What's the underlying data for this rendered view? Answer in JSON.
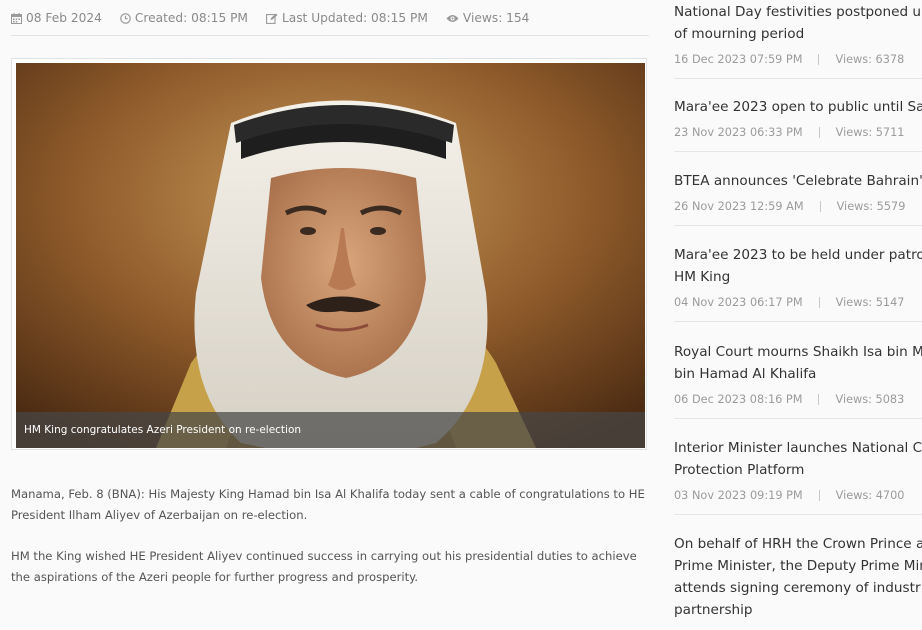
{
  "article": {
    "date": "08 Feb 2024",
    "created": "Created: 08:15 PM",
    "updated": "Last Updated: 08:15 PM",
    "views": "Views: 154",
    "image_caption": "HM King congratulates Azeri President on re-election",
    "paragraphs": [
      "Manama, Feb. 8 (BNA): His Majesty King Hamad bin Isa Al Khalifa today sent a cable of congratulations to HE President Ilham Aliyev of Azerbaijan on re-election.",
      "HM the King wished HE President Aliyev continued success in carrying out his presidential duties to achieve the aspirations of the Azeri people for further progress and prosperity."
    ]
  },
  "sidebar": {
    "items": [
      {
        "title_lines": [
          "National Day festivities postponed u",
          "of mourning period"
        ],
        "date": "16 Dec 2023 07:59 PM",
        "views": "Views: 6378"
      },
      {
        "title_lines": [
          "Mara'ee 2023 open to public until Sa"
        ],
        "date": "23 Nov 2023 06:33 PM",
        "views": "Views: 5711"
      },
      {
        "title_lines": [
          "BTEA announces 'Celebrate Bahrain'"
        ],
        "date": "26 Nov 2023 12:59 AM",
        "views": "Views: 5579"
      },
      {
        "title_lines": [
          "Mara'ee 2023 to be held under patro",
          "HM King"
        ],
        "date": "04 Nov 2023 06:17 PM",
        "views": "Views: 5147"
      },
      {
        "title_lines": [
          "Royal Court mourns Shaikh Isa bin M",
          "bin Hamad Al Khalifa"
        ],
        "date": "06 Dec 2023 08:16 PM",
        "views": "Views: 5083"
      },
      {
        "title_lines": [
          "Interior Minister launches National C",
          "Protection Platform"
        ],
        "date": "03 Nov 2023 09:19 PM",
        "views": "Views: 4700"
      },
      {
        "title_lines": [
          "On behalf of HRH the Crown Prince a",
          "Prime Minister, the Deputy Prime Min",
          "attends signing ceremony of industr",
          "partnership"
        ],
        "date": "",
        "views": ""
      }
    ]
  },
  "icons": {
    "date": "calendar-icon",
    "created": "clock-icon",
    "updated": "edit-icon",
    "views": "eye-icon"
  }
}
